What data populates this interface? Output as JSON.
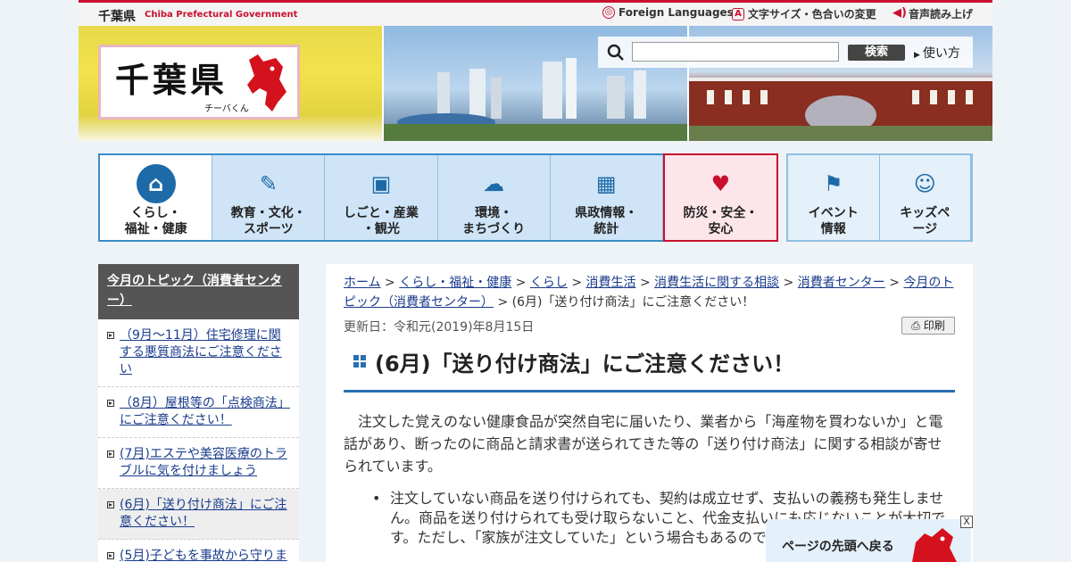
{
  "header": {
    "site_name": "千葉県",
    "site_name_en": "Chiba Prefectural Government",
    "logo_text": "千葉県",
    "logo_sub": "チーバくん",
    "util_links": [
      {
        "label": "Foreign Languages",
        "icon": "globe-icon"
      },
      {
        "label": "文字サイズ・色合いの変更",
        "icon": "text-size-icon"
      },
      {
        "label": "音声読み上げ",
        "icon": "speaker-icon"
      }
    ],
    "search": {
      "placeholder": "",
      "button": "検索",
      "usage": "使い方"
    }
  },
  "nav": {
    "items": [
      {
        "label": "くらし・\n福祉・健康",
        "icon": "house-icon"
      },
      {
        "label": "教育・文化・\nスポーツ",
        "icon": "sports-icon"
      },
      {
        "label": "しごと・産業\n・観光",
        "icon": "briefcase-icon"
      },
      {
        "label": "環境・\nまちづくり",
        "icon": "weather-icon"
      },
      {
        "label": "県政情報・\n統計",
        "icon": "building-icon"
      },
      {
        "label": "防災・安全・\n安心",
        "icon": "heart-icon"
      }
    ],
    "extra": [
      {
        "label": "イベント\n情報",
        "icon": "flag-icon"
      },
      {
        "label": "キッズペ\nージ",
        "icon": "kids-icon"
      }
    ]
  },
  "sidebar": {
    "heading": "今月のトピック（消費者センター）",
    "items": [
      "（9月～11月）住宅修理に関する悪質商法にご注意ください",
      "（8月）屋根等の「点検商法」にご注意ください！",
      "(7月)エステや美容医療のトラブルに気を付けましょう",
      "(6月)「送り付け商法」にご注意ください！",
      "(5月)子どもを事故から守りま"
    ]
  },
  "breadcrumb": {
    "links": [
      "ホーム",
      "くらし・福祉・健康",
      "くらし",
      "消費生活",
      "消費生活に関する相談",
      "消費者センター",
      "今月のトピック（消費者センター）"
    ],
    "current": "(6月)「送り付け商法」にご注意ください！"
  },
  "main": {
    "updated": "更新日：令和元(2019)年8月15日",
    "print": "印刷",
    "title": "(6月)「送り付け商法」にご注意ください！",
    "intro": "注文した覚えのない健康食品が突然自宅に届いたり、業者から「海産物を買わないか」と電話があり、断ったのに商品と請求書が送られてきた等の「送り付け商法」に関する相談が寄せられています。",
    "bullets": [
      "注文していない商品を送り付けられても、契約は成立せず、支払いの義務も発生しません。商品を送り付けられても受け取らないこと、代金支払いにも応じないことが大切です。ただし、「家族が注文していた」という場合もあるので確認しましょう。"
    ]
  },
  "to_top": {
    "label": "ページの先頭へ戻る",
    "close": "X"
  }
}
